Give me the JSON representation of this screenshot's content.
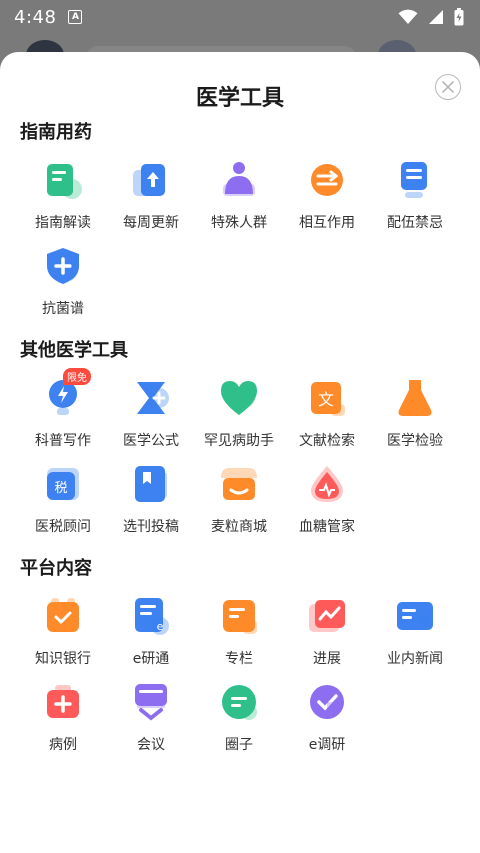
{
  "status_bar": {
    "time": "4:48",
    "notification_icon": "a-letter-icon"
  },
  "sheet": {
    "title": "医学工具",
    "close_icon": "close-icon"
  },
  "sections": [
    {
      "title": "指南用药",
      "items": [
        {
          "label": "指南解读",
          "icon": "guide-doc-icon",
          "color": "#2fbf8a"
        },
        {
          "label": "每周更新",
          "icon": "weekly-update-icon",
          "color": "#3d82f0"
        },
        {
          "label": "特殊人群",
          "icon": "special-group-icon",
          "color": "#8d6ef0"
        },
        {
          "label": "相互作用",
          "icon": "interaction-icon",
          "color": "#ff8a2a"
        },
        {
          "label": "配伍禁忌",
          "icon": "compatibility-icon",
          "color": "#3d82f0"
        },
        {
          "label": "抗菌谱",
          "icon": "antibacterial-shield-icon",
          "color": "#3d82f0"
        }
      ]
    },
    {
      "title": "其他医学工具",
      "items": [
        {
          "label": "科普写作",
          "icon": "lightbulb-icon",
          "color": "#3d82f0",
          "badge": "限免"
        },
        {
          "label": "医学公式",
          "icon": "formula-icon",
          "color": "#3d82f0"
        },
        {
          "label": "罕见病助手",
          "icon": "rare-disease-heart-icon",
          "color": "#2fbf8a"
        },
        {
          "label": "文献检索",
          "icon": "literature-search-icon",
          "color": "#ff8a2a"
        },
        {
          "label": "医学检验",
          "icon": "flask-icon",
          "color": "#ff8a2a"
        },
        {
          "label": "医税顾问",
          "icon": "tax-icon",
          "color": "#3d82f0"
        },
        {
          "label": "选刊投稿",
          "icon": "journal-submit-icon",
          "color": "#3d82f0"
        },
        {
          "label": "麦粒商城",
          "icon": "shop-icon",
          "color": "#ff8a2a"
        },
        {
          "label": "血糖管家",
          "icon": "blood-sugar-icon",
          "color": "#ff5a5a"
        }
      ]
    },
    {
      "title": "平台内容",
      "items": [
        {
          "label": "知识银行",
          "icon": "knowledge-bank-icon",
          "color": "#ff8a2a"
        },
        {
          "label": "e研通",
          "icon": "e-research-icon",
          "color": "#3d82f0"
        },
        {
          "label": "专栏",
          "icon": "column-icon",
          "color": "#ff8a2a"
        },
        {
          "label": "进展",
          "icon": "progress-chart-icon",
          "color": "#ff5a5a"
        },
        {
          "label": "业内新闻",
          "icon": "news-icon",
          "color": "#3d82f0"
        },
        {
          "label": "病例",
          "icon": "case-icon",
          "color": "#ff5a5a"
        },
        {
          "label": "会议",
          "icon": "meeting-icon",
          "color": "#8d6ef0"
        },
        {
          "label": "圈子",
          "icon": "circle-chat-icon",
          "color": "#2fbf8a"
        },
        {
          "label": "e调研",
          "icon": "e-survey-icon",
          "color": "#8d6ef0"
        }
      ]
    }
  ]
}
